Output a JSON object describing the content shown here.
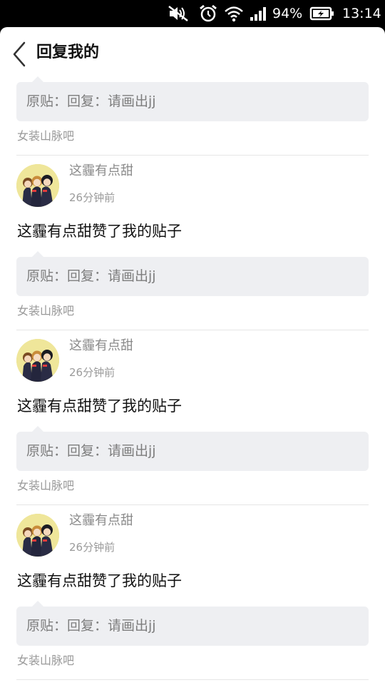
{
  "status_bar": {
    "battery_percent": "94%",
    "time": "13:14",
    "icons": [
      "mute-icon",
      "alarm-icon",
      "wifi-icon",
      "signal-icon",
      "battery-charging-icon"
    ]
  },
  "header": {
    "title": "回复我的",
    "back_icon": "chevron-left-icon"
  },
  "top_partial_item": {
    "quote": "原贴：回复：请画出jj",
    "forum": "女装山脉吧"
  },
  "items": [
    {
      "username": "这霾有点甜",
      "time": "26分钟前",
      "message": "这霾有点甜赞了我的贴子",
      "quote": "原贴：回复：请画出jj",
      "forum": "女装山脉吧"
    },
    {
      "username": "这霾有点甜",
      "time": "26分钟前",
      "message": "这霾有点甜赞了我的贴子",
      "quote": "原贴：回复：请画出jj",
      "forum": "女装山脉吧"
    },
    {
      "username": "这霾有点甜",
      "time": "26分钟前",
      "message": "这霾有点甜赞了我的贴子",
      "quote": "原贴：回复：请画出jj",
      "forum": "女装山脉吧"
    }
  ],
  "colors": {
    "status_bar_bg": "#000000",
    "screen_bg": "#ffffff",
    "quote_bg": "#eeeff2",
    "primary_text": "#111111",
    "secondary_text": "#999999"
  }
}
